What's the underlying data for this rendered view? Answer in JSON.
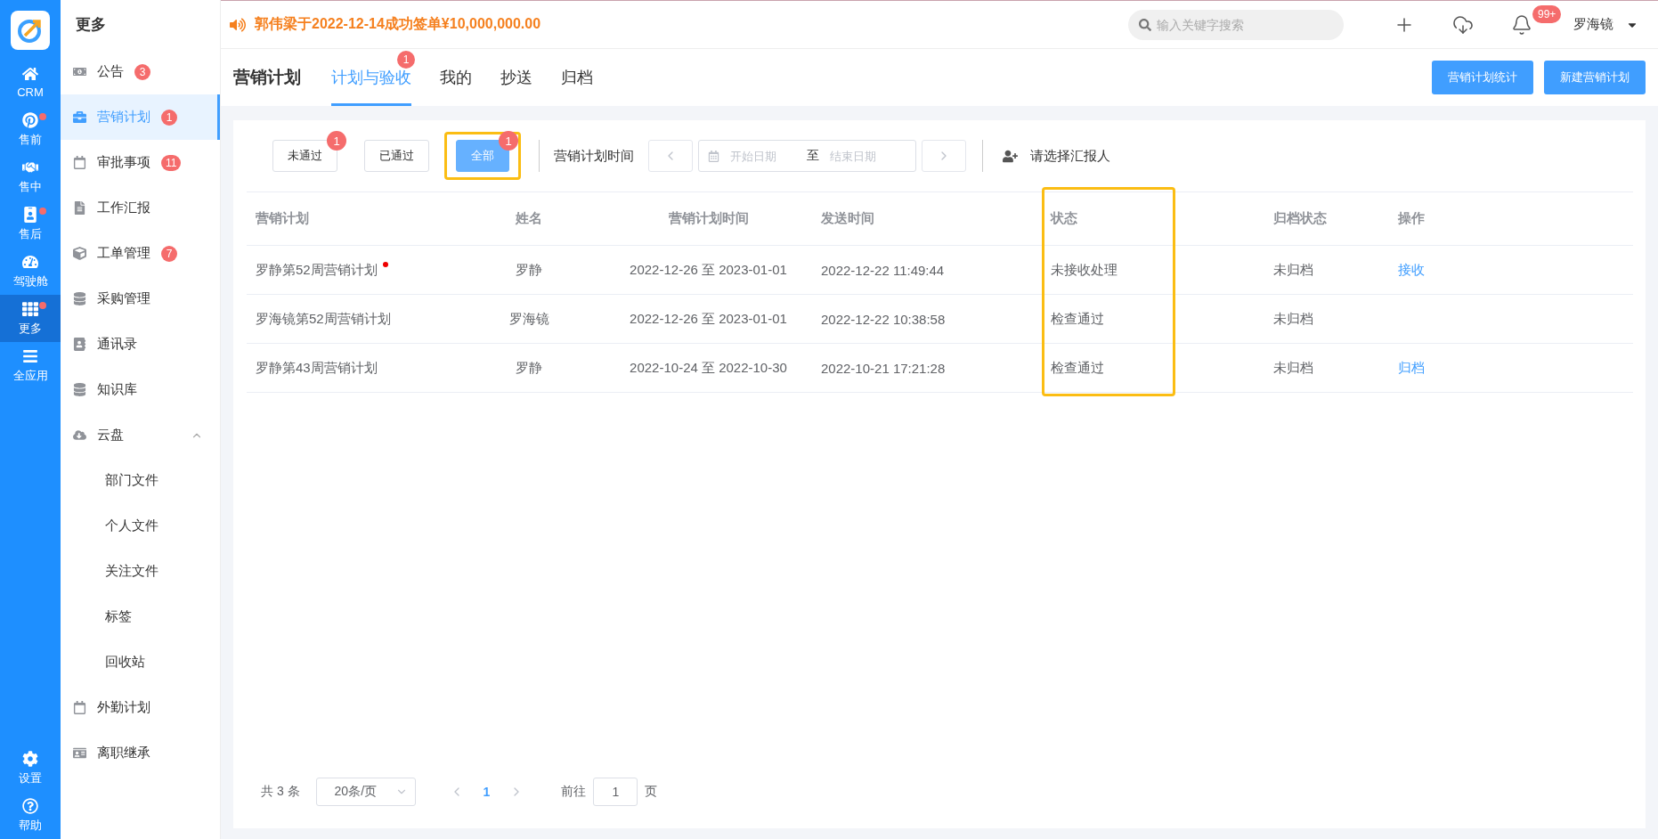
{
  "rail": {
    "items": [
      {
        "label": "CRM",
        "dot": false,
        "selected": false
      },
      {
        "label": "售前",
        "dot": true,
        "selected": false
      },
      {
        "label": "售中",
        "dot": false,
        "selected": false
      },
      {
        "label": "售后",
        "dot": true,
        "selected": false
      },
      {
        "label": "驾驶舱",
        "dot": false,
        "selected": false
      },
      {
        "label": "更多",
        "dot": true,
        "selected": true
      },
      {
        "label": "全应用",
        "dot": false,
        "selected": false
      }
    ],
    "bottom": [
      {
        "label": "设置"
      },
      {
        "label": "帮助"
      }
    ]
  },
  "sidebar": {
    "title": "更多",
    "items": [
      {
        "label": "公告",
        "badge": "3",
        "selected": false
      },
      {
        "label": "营销计划",
        "badge": "1",
        "selected": true
      },
      {
        "label": "审批事项",
        "badge": "11",
        "selected": false
      },
      {
        "label": "工作汇报",
        "selected": false
      },
      {
        "label": "工单管理",
        "badge": "7",
        "selected": false
      },
      {
        "label": "采购管理",
        "selected": false
      },
      {
        "label": "通讯录",
        "selected": false
      },
      {
        "label": "知识库",
        "selected": false
      },
      {
        "label": "云盘",
        "selected": false,
        "expanded": true,
        "children": [
          {
            "label": "部门文件",
            "selected": false
          },
          {
            "label": "个人文件",
            "selected": false
          },
          {
            "label": "关注文件",
            "selected": false
          },
          {
            "label": "标签",
            "selected": false
          },
          {
            "label": "回收站",
            "selected": false
          }
        ]
      },
      {
        "label": "外勤计划",
        "selected": false
      },
      {
        "label": "离职继承",
        "selected": false
      }
    ]
  },
  "notice": {
    "text": "郭伟梁于2022-12-14成功签单¥10,000,000.00"
  },
  "search": {
    "placeholder": "输入关键字搜索"
  },
  "notifications": {
    "badge": "99+"
  },
  "user": {
    "name": "罗海镜"
  },
  "page": {
    "title": "营销计划",
    "tabs": [
      {
        "label": "计划与验收",
        "selected": true,
        "badge": "1"
      },
      {
        "label": "我的",
        "selected": false
      },
      {
        "label": "抄送",
        "selected": false
      },
      {
        "label": "归档",
        "selected": false
      }
    ],
    "actions": [
      "营销计划统计",
      "新建营销计划"
    ]
  },
  "filters": {
    "buttons": [
      {
        "label": "未通过",
        "selected": false,
        "badge": "1",
        "highlighted": false
      },
      {
        "label": "已通过",
        "selected": false,
        "highlighted": false
      },
      {
        "label": "全部",
        "selected": true,
        "badge": "1",
        "highlighted": true
      }
    ],
    "date_label": "营销计划时间",
    "start_placeholder": "开始日期",
    "separator": "至",
    "end_placeholder": "结束日期",
    "reporter_placeholder": "请选择汇报人"
  },
  "table": {
    "columns": [
      {
        "label": "营销计划",
        "highlighted": false
      },
      {
        "label": "姓名",
        "highlighted": false
      },
      {
        "label": "营销计划时间",
        "highlighted": false
      },
      {
        "label": "发送时间",
        "highlighted": false
      },
      {
        "label": "状态",
        "highlighted": true
      },
      {
        "label": "归档状态",
        "highlighted": false
      },
      {
        "label": "操作",
        "highlighted": false
      }
    ],
    "rows": [
      {
        "cells": [
          "罗静第52周营销计划",
          "罗静",
          "2022-12-26 至 2023-01-01",
          "2022-12-22 11:49:44",
          "未接收处理",
          "未归档"
        ],
        "unread": true,
        "action": "接收"
      },
      {
        "cells": [
          "罗海镜第52周营销计划",
          "罗海镜",
          "2022-12-26 至 2023-01-01",
          "2022-12-22 10:38:58",
          "检查通过",
          "未归档"
        ],
        "unread": false
      },
      {
        "cells": [
          "罗静第43周营销计划",
          "罗静",
          "2022-10-24 至 2022-10-30",
          "2022-10-21 17:21:28",
          "检查通过",
          "未归档"
        ],
        "unread": false,
        "action": "归档"
      }
    ]
  },
  "pagination": {
    "total": "共 3 条",
    "page_size": "20条/页",
    "pages": [
      {
        "label": "1",
        "selected": true
      }
    ],
    "goto_label": "前往",
    "goto_value": "1",
    "goto_suffix": "页"
  }
}
